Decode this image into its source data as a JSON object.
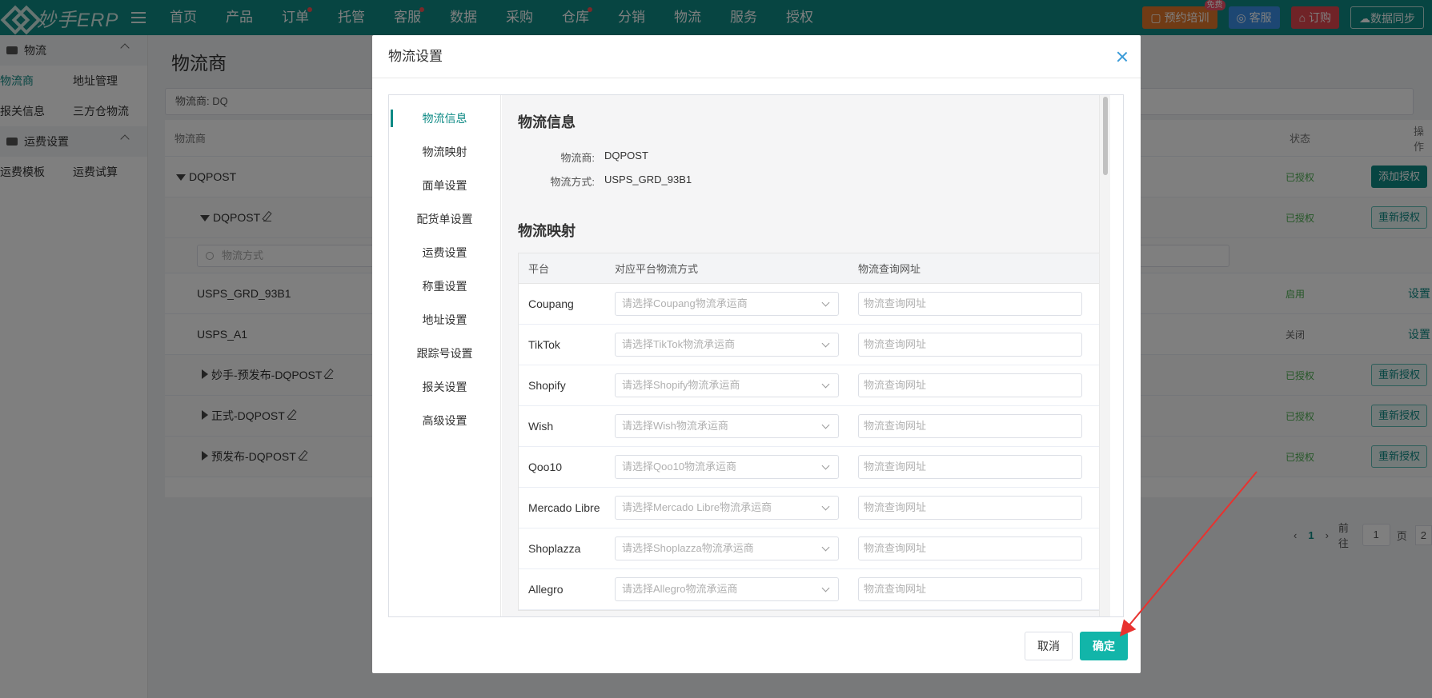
{
  "app": {
    "logo_text": "妙手ERP"
  },
  "nav": {
    "items": [
      {
        "label": "首页",
        "dot": false
      },
      {
        "label": "产品",
        "dot": false
      },
      {
        "label": "订单",
        "dot": true
      },
      {
        "label": "托管",
        "dot": false
      },
      {
        "label": "客服",
        "dot": true
      },
      {
        "label": "数据",
        "dot": false
      },
      {
        "label": "采购",
        "dot": false
      },
      {
        "label": "仓库",
        "dot": true
      },
      {
        "label": "分销",
        "dot": false
      },
      {
        "label": "物流",
        "dot": false
      },
      {
        "label": "服务",
        "dot": false
      },
      {
        "label": "授权",
        "dot": false
      }
    ],
    "actions": {
      "training": "预约培训",
      "training_badge": "免费",
      "service": "客服",
      "subscribe": "订购",
      "sync": "数据同步"
    }
  },
  "sidebar": {
    "group1": "物流",
    "links1": [
      "物流商",
      "地址管理",
      "报关信息",
      "三方仓物流"
    ],
    "group2": "运费设置",
    "links2": [
      "运费模板",
      "运费试算"
    ]
  },
  "main": {
    "title": "物流商",
    "filter": "物流商:  DQ",
    "headers": {
      "provider": "物流商",
      "status": "状态",
      "action": "操作"
    },
    "search_placeholder": "物流方式",
    "rows": {
      "r0": {
        "name": "DQPOST",
        "status": "已授权",
        "btn": "添加授权"
      },
      "r1": {
        "name": "DQPOST",
        "status": "已授权",
        "btn": "重新授权"
      },
      "r3": {
        "name": "USPS_GRD_93B1",
        "status": "启用",
        "link": "设置"
      },
      "r4": {
        "name": "USPS_A1",
        "status": "关闭",
        "link": "设置"
      },
      "r5": {
        "name": "妙手-预发布-DQPOST",
        "status": "已授权",
        "btn": "重新授权"
      },
      "r6": {
        "name": "正式-DQPOST",
        "status": "已授权",
        "btn": "重新授权"
      },
      "r7": {
        "name": "预发布-DQPOST",
        "status": "已授权",
        "btn": "重新授权"
      }
    },
    "pager": {
      "current": "1",
      "goto": "前往",
      "page_value": "1",
      "page_unit": "页",
      "next_hint": "2"
    }
  },
  "modal": {
    "title": "物流设置",
    "tabs": [
      "物流信息",
      "物流映射",
      "面单设置",
      "配货单设置",
      "运费设置",
      "称重设置",
      "地址设置",
      "跟踪号设置",
      "报关设置",
      "高级设置"
    ],
    "info": {
      "section_title": "物流信息",
      "provider_label": "物流商:",
      "provider_value": "DQPOST",
      "method_label": "物流方式:",
      "method_value": "USPS_GRD_93B1"
    },
    "mapping": {
      "section_title": "物流映射",
      "headers": {
        "platform": "平台",
        "carrier": "对应平台物流方式",
        "url": "物流查询网址"
      },
      "url_placeholder": "物流查询网址",
      "rows": [
        {
          "platform": "Coupang",
          "select": "请选择Coupang物流承运商"
        },
        {
          "platform": "TikTok",
          "select": "请选择TikTok物流承运商"
        },
        {
          "platform": "Shopify",
          "select": "请选择Shopify物流承运商"
        },
        {
          "platform": "Wish",
          "select": "请选择Wish物流承运商"
        },
        {
          "platform": "Qoo10",
          "select": "请选择Qoo10物流承运商"
        },
        {
          "platform": "Mercado Libre",
          "select": "请选择Mercado Libre物流承运商"
        },
        {
          "platform": "Shoplazza",
          "select": "请选择Shoplazza物流承运商"
        },
        {
          "platform": "Allegro",
          "select": "请选择Allegro物流承运商"
        }
      ]
    },
    "buttons": {
      "cancel": "取消",
      "confirm": "确定"
    }
  },
  "colors": {
    "brand": "#0e8a85",
    "confirm": "#12b5a9",
    "annotation_arrow": "#e8322f"
  }
}
